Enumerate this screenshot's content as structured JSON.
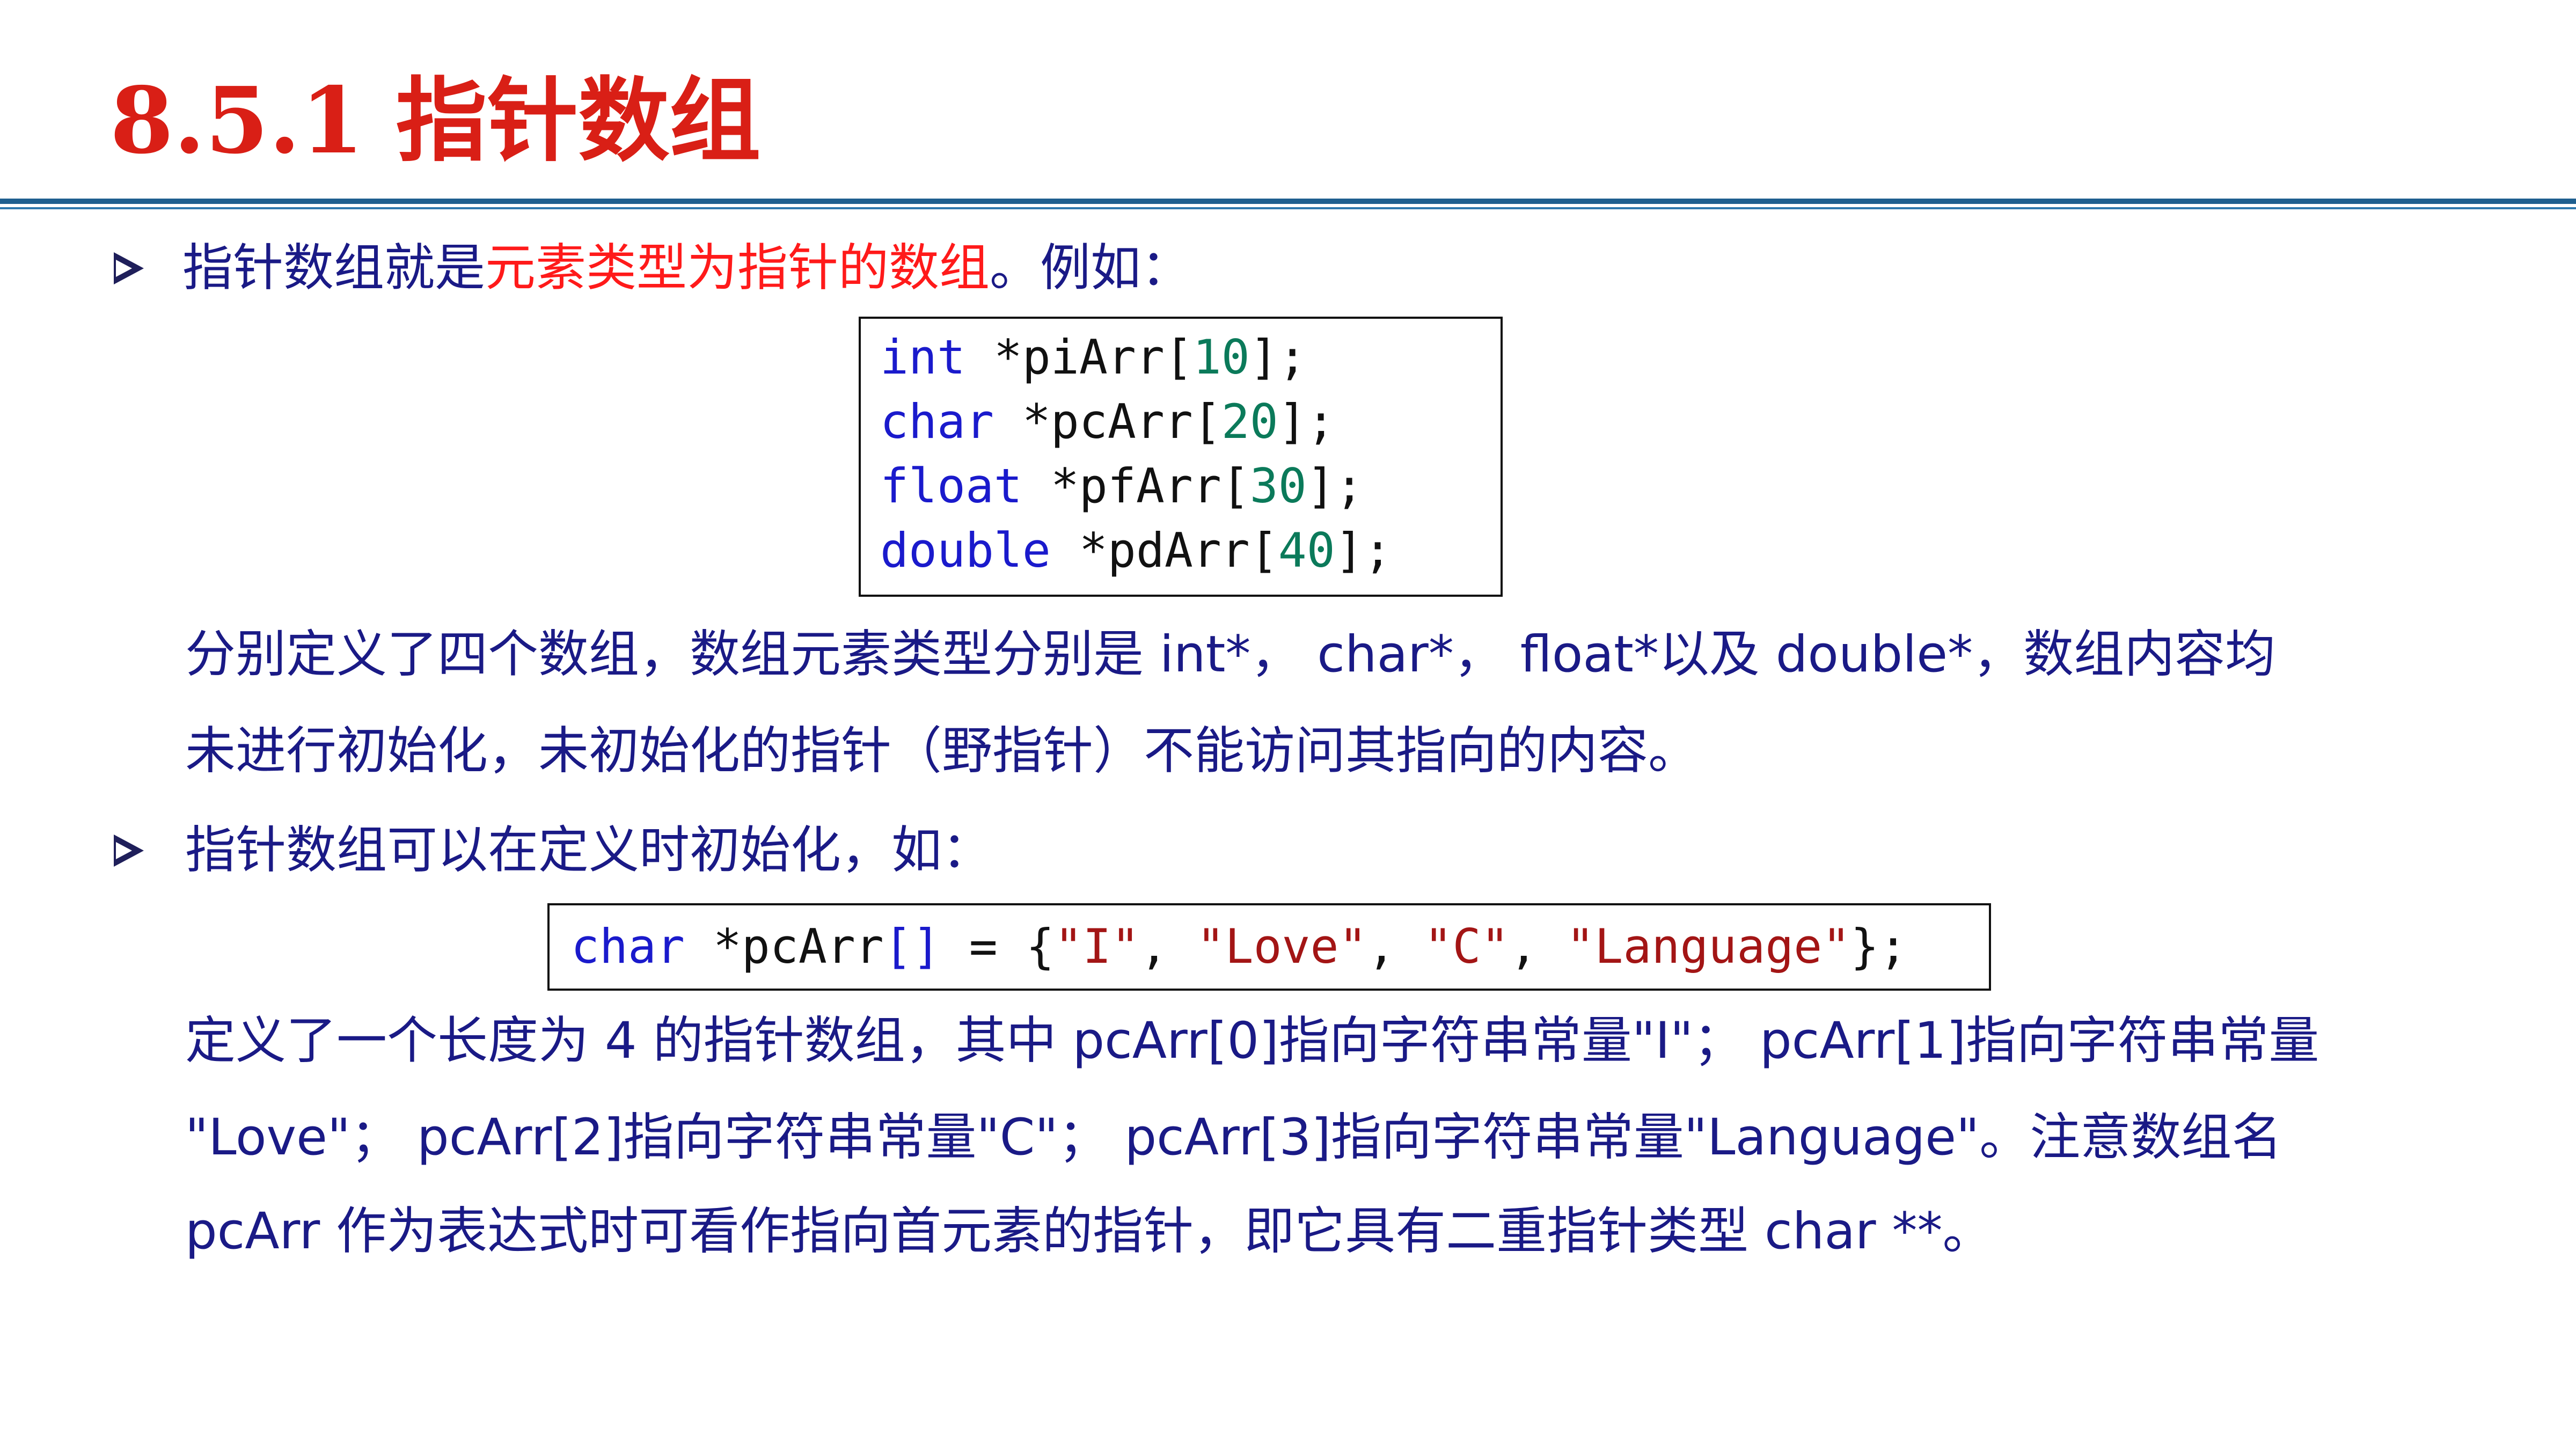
{
  "title": "8.5.1 指针数组",
  "colors": {
    "title": "#d91f16",
    "body_text": "#1a1a86",
    "highlight": "#ff1a1a",
    "keyword": "#1a1acc",
    "number": "#0b7a5a",
    "string": "#a31515",
    "rule": "#1f5f8f"
  },
  "icons": {
    "bullet": "arrow-bullet-icon"
  },
  "section1": {
    "prefix": "指针数组就是",
    "highlight": "元素类型为指针的数组",
    "suffix": "。例如："
  },
  "code1": {
    "lines": [
      {
        "type": "int",
        "rest": " *piArr[",
        "num": "10",
        "end": "];"
      },
      {
        "type": "char",
        "rest": " *pcArr[",
        "num": "20",
        "end": "];"
      },
      {
        "type": "float",
        "rest": " *pfArr[",
        "num": "30",
        "end": "];"
      },
      {
        "type": "double",
        "rest": " *pdArr[",
        "num": "40",
        "end": "];"
      }
    ]
  },
  "paragraph1": {
    "line1": "分别定义了四个数组，数组元素类型分别是 int*， char*， float*以及 double*，数组内容均",
    "line2": "未进行初始化，未初始化的指针（野指针）不能访问其指向的内容。"
  },
  "section2": {
    "text": "指针数组可以在定义时初始化，如："
  },
  "code2": {
    "type": "char",
    "name": " *pcArr",
    "brackets": "[]",
    "assign": " = {",
    "s1": "\"I\"",
    "sep1": ", ",
    "s2": "\"Love\"",
    "sep2": ", ",
    "s3": "\"C\"",
    "sep3": ", ",
    "s4": "\"Language\"",
    "end": "};"
  },
  "paragraph2": {
    "line1": "定义了一个长度为 4 的指针数组，其中 pcArr[0]指向字符串常量\"I\"； pcArr[1]指向字符串常量",
    "line2": "\"Love\"； pcArr[2]指向字符串常量\"C\"； pcArr[3]指向字符串常量\"Language\"。注意数组名",
    "line3": "pcArr 作为表达式时可看作指向首元素的指针，即它具有二重指针类型 char **。"
  }
}
